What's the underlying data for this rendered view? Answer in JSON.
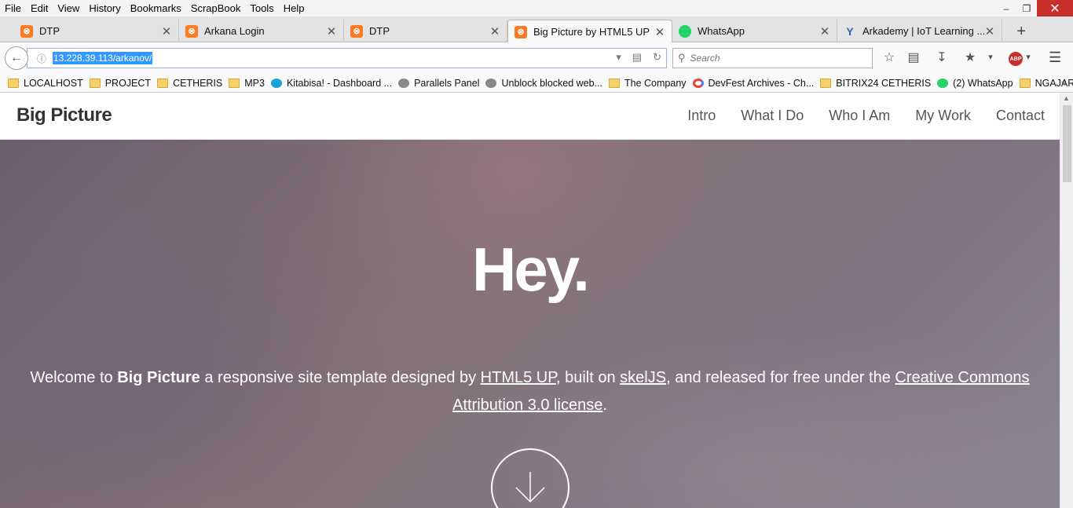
{
  "menubar": {
    "items": [
      "File",
      "Edit",
      "View",
      "History",
      "Bookmarks",
      "ScrapBook",
      "Tools",
      "Help"
    ]
  },
  "tabs": [
    {
      "label": "DTP",
      "icon": "xampp-icon"
    },
    {
      "label": "Arkana Login",
      "icon": "xampp-icon"
    },
    {
      "label": "DTP",
      "icon": "xampp-icon"
    },
    {
      "label": "Big Picture by HTML5 UP",
      "icon": "xampp-icon",
      "active": true
    },
    {
      "label": "WhatsApp",
      "icon": "whatsapp-icon"
    },
    {
      "label": "Arkademy | IoT Learning ...",
      "icon": "arkademy-icon"
    }
  ],
  "navbar": {
    "url": "13.228.39.113/arkanov/",
    "search_placeholder": "Search"
  },
  "bookmarks": [
    {
      "label": "LOCALHOST",
      "icon": "folder-icon"
    },
    {
      "label": "PROJECT",
      "icon": "folder-icon"
    },
    {
      "label": "CETHERIS",
      "icon": "folder-icon"
    },
    {
      "label": "MP3",
      "icon": "folder-icon"
    },
    {
      "label": "Kitabisa! - Dashboard ...",
      "icon": "kitabisa-icon"
    },
    {
      "label": "Parallels Panel",
      "icon": "globe-icon"
    },
    {
      "label": "Unblock blocked web...",
      "icon": "globe-icon"
    },
    {
      "label": "The Company",
      "icon": "folder-icon"
    },
    {
      "label": "DevFest Archives - Ch...",
      "icon": "devfest-icon"
    },
    {
      "label": "BITRIX24 CETHERIS",
      "icon": "folder-icon"
    },
    {
      "label": "(2) WhatsApp",
      "icon": "whatsapp-icon"
    },
    {
      "label": "NGAJAR",
      "icon": "folder-icon"
    }
  ],
  "site": {
    "logo": "Big Picture",
    "nav": [
      "Intro",
      "What I Do",
      "Who I Am",
      "My Work",
      "Contact"
    ],
    "hero": {
      "heading": "Hey.",
      "intro_welcome": "Welcome to ",
      "intro_brand": "Big Picture",
      "intro_mid": " a responsive site template designed by ",
      "intro_link1": "HTML5 UP",
      "intro_mid2": ", built on ",
      "intro_link2": "skelJS",
      "intro_mid3": ", and released for free under the ",
      "intro_link3": "Creative Commons Attribution 3.0 license",
      "intro_end": "."
    }
  },
  "colors": {
    "accent_close": "#c7302a",
    "xampp": "#fb7a24",
    "whatsapp": "#25d366",
    "selection": "#3399ff"
  }
}
